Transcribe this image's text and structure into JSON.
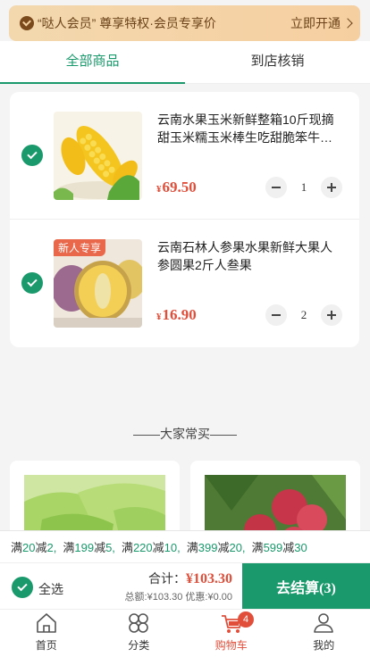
{
  "member": {
    "text": "“哒人会员” 尊享特权·会员专享价",
    "action": "立即开通"
  },
  "tabs": [
    {
      "label": "全部商品",
      "active": true
    },
    {
      "label": "到店核销",
      "active": false
    }
  ],
  "cart_items": [
    {
      "name": "云南水果玉米新鲜整箱10斤现摘甜玉米糯玉米棒生吃甜脆笨牛…",
      "currency": "¥",
      "price": "69.50",
      "qty": "1",
      "checked": true
    },
    {
      "name": "云南石林人参果水果新鲜大果人参圆果2斤人叁果",
      "currency": "¥",
      "price": "16.90",
      "qty": "2",
      "checked": true,
      "badge": "新人专享"
    }
  ],
  "common": {
    "title": "大家常买"
  },
  "promos": [
    {
      "prefix": "满",
      "a": "20",
      "mid": "减",
      "b": "2,"
    },
    {
      "prefix": "满",
      "a": "199",
      "mid": "减",
      "b": "5,"
    },
    {
      "prefix": "满",
      "a": "220",
      "mid": "减",
      "b": "10,"
    },
    {
      "prefix": "满",
      "a": "399",
      "mid": "减",
      "b": "20,"
    },
    {
      "prefix": "满",
      "a": "599",
      "mid": "减",
      "b": "30"
    }
  ],
  "checkout": {
    "select_all": "全选",
    "total_label": "合计：",
    "total": "¥103.30",
    "sum_line": "总额:¥103.30   优惠:¥0.00",
    "pay_button": "去结算(3)"
  },
  "nav": [
    {
      "label": "首页",
      "icon": "home-icon"
    },
    {
      "label": "分类",
      "icon": "category-icon"
    },
    {
      "label": "购物车",
      "icon": "cart-icon",
      "active": true,
      "badge": "4"
    },
    {
      "label": "我的",
      "icon": "user-icon"
    }
  ],
  "colors": {
    "accent": "#1a9a6c",
    "price": "#e14f3b",
    "member_bg": "#f3d8ae"
  }
}
